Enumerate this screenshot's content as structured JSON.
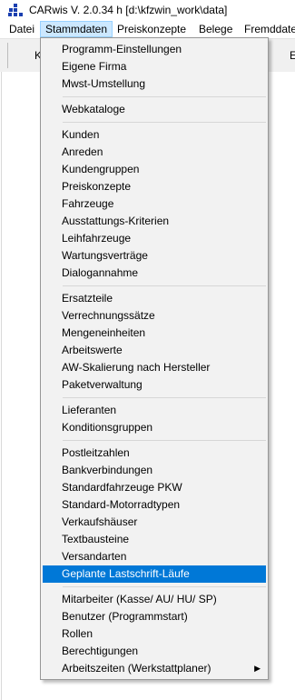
{
  "window": {
    "title": "CARwis V. 2.0.34 h  [d:\\kfzwin_work\\data]"
  },
  "menubar": {
    "items": [
      {
        "label": "Datei"
      },
      {
        "label": "Stammdaten"
      },
      {
        "label": "Preiskonzepte"
      },
      {
        "label": "Belege"
      },
      {
        "label": "Fremddaten"
      }
    ]
  },
  "toolbar": {
    "left_text": "K",
    "right_text": "E"
  },
  "dropdown": {
    "groups": [
      {
        "items": [
          {
            "label": "Programm-Einstellungen"
          },
          {
            "label": "Eigene Firma"
          },
          {
            "label": "Mwst-Umstellung"
          }
        ]
      },
      {
        "items": [
          {
            "label": "Webkataloge"
          }
        ]
      },
      {
        "items": [
          {
            "label": "Kunden"
          },
          {
            "label": "Anreden"
          },
          {
            "label": "Kundengruppen"
          },
          {
            "label": "Preiskonzepte"
          },
          {
            "label": "Fahrzeuge"
          },
          {
            "label": "Ausstattungs-Kriterien"
          },
          {
            "label": "Leihfahrzeuge"
          },
          {
            "label": "Wartungsverträge"
          },
          {
            "label": "Dialogannahme"
          }
        ]
      },
      {
        "items": [
          {
            "label": "Ersatzteile"
          },
          {
            "label": "Verrechnungssätze"
          },
          {
            "label": "Mengeneinheiten"
          },
          {
            "label": "Arbeitswerte"
          },
          {
            "label": "AW-Skalierung nach Hersteller"
          },
          {
            "label": "Paketverwaltung"
          }
        ]
      },
      {
        "items": [
          {
            "label": "Lieferanten"
          },
          {
            "label": "Konditionsgruppen"
          }
        ]
      },
      {
        "items": [
          {
            "label": "Postleitzahlen"
          },
          {
            "label": "Bankverbindungen"
          },
          {
            "label": "Standardfahrzeuge PKW"
          },
          {
            "label": "Standard-Motorradtypen"
          },
          {
            "label": "Verkaufshäuser"
          },
          {
            "label": "Textbausteine"
          },
          {
            "label": "Versandarten"
          },
          {
            "label": "Geplante Lastschrift-Läufe",
            "highlighted": true
          }
        ]
      },
      {
        "items": [
          {
            "label": "Mitarbeiter (Kasse/ AU/ HU/ SP)"
          },
          {
            "label": "Benutzer (Programmstart)"
          },
          {
            "label": "Rollen"
          },
          {
            "label": "Berechtigungen"
          },
          {
            "label": "Arbeitszeiten (Werkstattplaner)",
            "submenu": true
          }
        ]
      }
    ],
    "submenu_arrow": "▶"
  },
  "colors": {
    "highlight": "#0078d7",
    "menu_active": "#cce8ff",
    "menu_bg": "#f2f2f2"
  }
}
